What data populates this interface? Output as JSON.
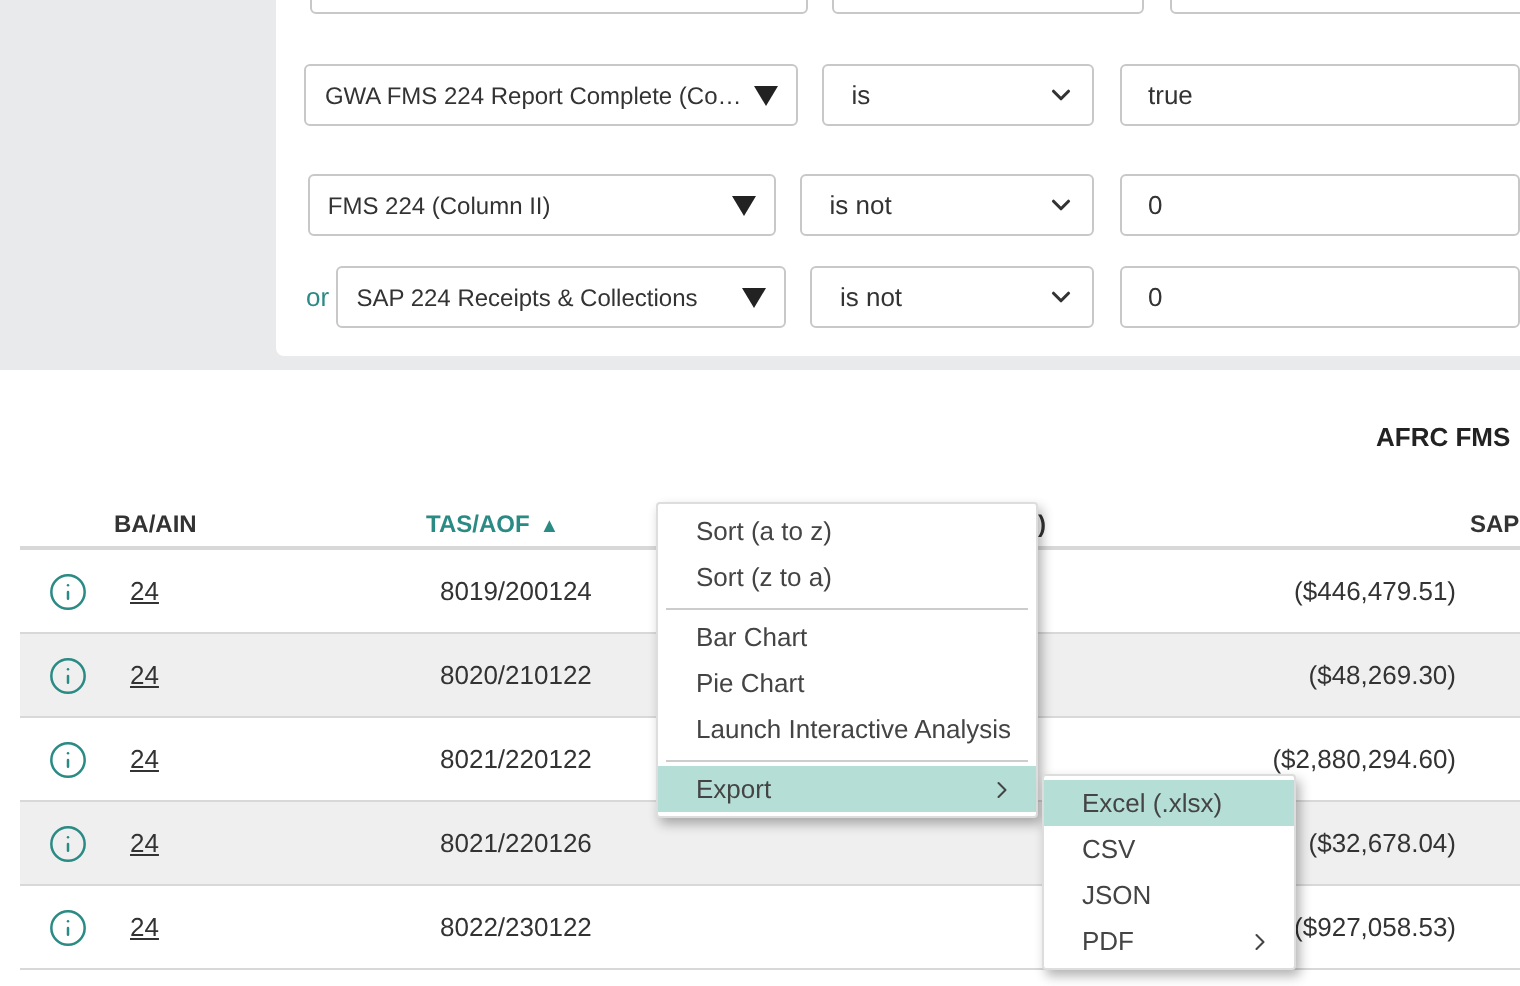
{
  "filters": [
    {
      "field": "GWA FMS 224 Report Complete (Co…",
      "operator": "is",
      "value": "true"
    },
    {
      "field": "FMS 224 (Column II)",
      "operator": "is not",
      "value": "0"
    },
    {
      "connector": "or",
      "field": "SAP 224 Receipts & Collections",
      "operator": "is not",
      "value": "0"
    }
  ],
  "table": {
    "group_header": "AFRC FMS",
    "columns": [
      {
        "label": "BA/AIN",
        "selected": false
      },
      {
        "label": "TAS/AOF",
        "selected": true,
        "sort_indicator": "▲"
      },
      {
        "label": ")",
        "selected": false
      },
      {
        "label": "SAP",
        "selected": false
      }
    ],
    "rows": [
      {
        "ba_ain": "24",
        "tas_aof": "8019/200124",
        "amount": "($446,479.51)"
      },
      {
        "ba_ain": "24",
        "tas_aof": "8020/210122",
        "amount": "($48,269.30)"
      },
      {
        "ba_ain": "24",
        "tas_aof": "8021/220122",
        "amount": "($2,880,294.60)"
      },
      {
        "ba_ain": "24",
        "tas_aof": "8021/220126",
        "amount": "($32,678.04)"
      },
      {
        "ba_ain": "24",
        "tas_aof": "8022/230122",
        "amount": "($927,058.53)"
      }
    ]
  },
  "context_menu": {
    "groups": [
      [
        {
          "label": "Sort (a to z)",
          "selected": false,
          "submenu": false
        },
        {
          "label": "Sort (z to a)",
          "selected": false,
          "submenu": false
        }
      ],
      [
        {
          "label": "Bar Chart",
          "selected": false,
          "submenu": false
        },
        {
          "label": "Pie Chart",
          "selected": false,
          "submenu": false
        },
        {
          "label": "Launch Interactive Analysis",
          "selected": false,
          "submenu": false
        }
      ],
      [
        {
          "label": "Export",
          "selected": true,
          "submenu": true
        }
      ]
    ],
    "submenu": [
      {
        "label": "Excel (.xlsx)",
        "selected": true,
        "submenu": false
      },
      {
        "label": "CSV",
        "selected": false,
        "submenu": false
      },
      {
        "label": "JSON",
        "selected": false,
        "submenu": false
      },
      {
        "label": "PDF",
        "selected": false,
        "submenu": true
      }
    ]
  }
}
